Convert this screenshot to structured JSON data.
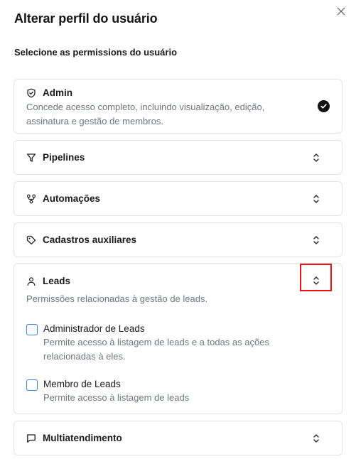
{
  "dialog": {
    "title": "Alterar perfil do usuário",
    "subtitle": "Selecione as permissions do usuário"
  },
  "cards": {
    "admin": {
      "title": "Admin",
      "description": "Concede acesso completo, incluindo visualização, edição, assinatura e gestão de membros.",
      "icon": "shield-icon",
      "selected": true
    },
    "pipelines": {
      "title": "Pipelines",
      "icon": "filter-icon"
    },
    "automacoes": {
      "title": "Automações",
      "icon": "workflow-icon"
    },
    "cadastros": {
      "title": "Cadastros auxiliares",
      "icon": "tag-icon"
    },
    "leads": {
      "title": "Leads",
      "icon": "user-icon",
      "description": "Permissões relacionadas à gestão de leads.",
      "options": [
        {
          "title": "Administrador de Leads",
          "description": "Permite acesso à listagem de leads e a todas as ações relacionadas à eles.",
          "checked": false
        },
        {
          "title": "Membro de Leads",
          "description": "Permite acesso à listagem de leads",
          "checked": false
        }
      ]
    },
    "multiatendimento": {
      "title": "Multiatendimento",
      "icon": "message-icon"
    }
  },
  "colors": {
    "checkbox_border": "#3b82f6",
    "highlight": "#ee1111",
    "muted_text": "#70757d"
  }
}
